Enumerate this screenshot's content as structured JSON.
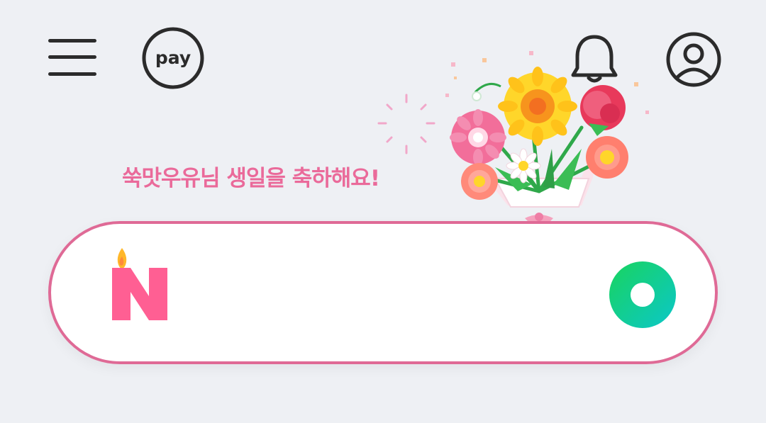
{
  "header": {
    "menu_icon": "hamburger-menu-icon",
    "pay_icon": "pay-icon",
    "pay_label": "pay",
    "notification_icon": "bell-icon",
    "profile_icon": "user-profile-icon"
  },
  "banner": {
    "greeting": "쑥맛우유님 생일을 축하해요!",
    "illustration": "flower-bouquet-icon"
  },
  "search": {
    "logo_icon": "naver-birthday-logo-icon",
    "value": "",
    "placeholder": "",
    "action_icon": "green-ring-button-icon"
  },
  "colors": {
    "background": "#eef0f4",
    "accent_pink": "#df6a96",
    "greeting_text": "#ea6a9a",
    "naver_pink": "#ff5f93",
    "green": "#03c75a"
  }
}
